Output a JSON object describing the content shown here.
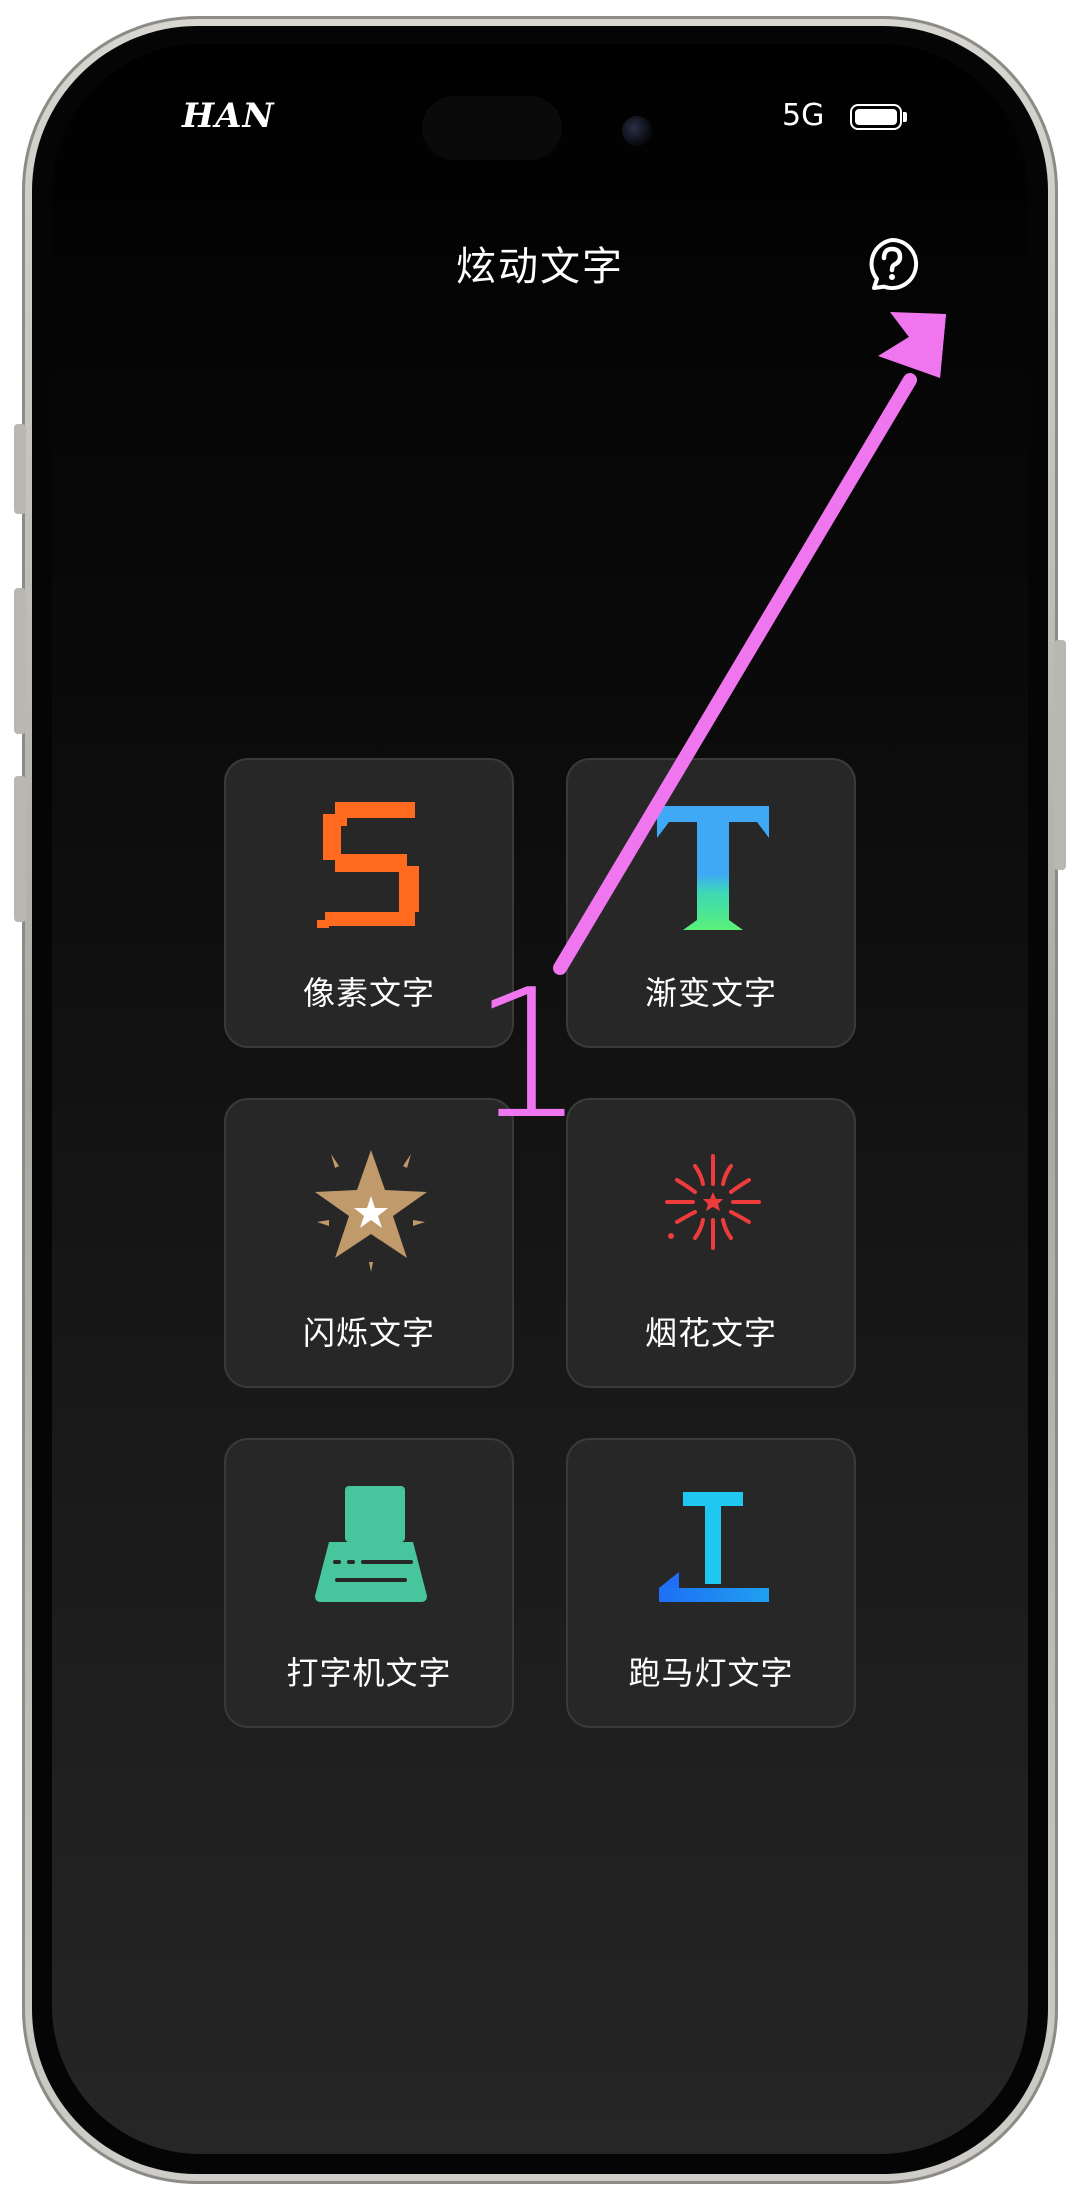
{
  "status_bar": {
    "carrier": "HAN",
    "network": "5G",
    "battery_level": 1.0
  },
  "header": {
    "title": "炫动文字",
    "help_icon": "question-circle-icon"
  },
  "tiles": [
    {
      "label": "像素文字",
      "icon": "pixel-s-icon",
      "color": "#ff6a1f"
    },
    {
      "label": "渐变文字",
      "icon": "gradient-t-icon",
      "color": "#3fa9f5"
    },
    {
      "label": "闪烁文字",
      "icon": "sparkle-star-icon",
      "color": "#c19a6b"
    },
    {
      "label": "烟花文字",
      "icon": "firework-icon",
      "color": "#ee3b3b"
    },
    {
      "label": "打字机文字",
      "icon": "typewriter-icon",
      "color": "#47c69d"
    },
    {
      "label": "跑马灯文字",
      "icon": "marquee-t-icon",
      "color": "#1fc8f0"
    }
  ],
  "annotation": {
    "number": "1",
    "color": "#f076ef"
  }
}
